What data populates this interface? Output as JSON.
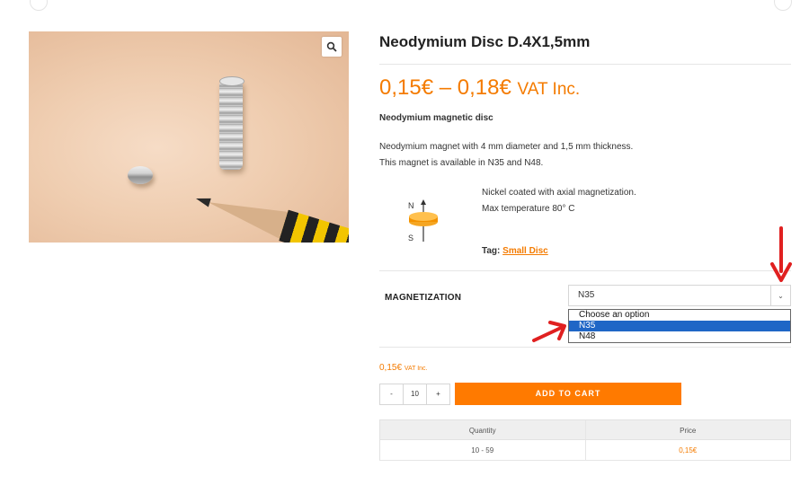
{
  "product": {
    "title": "Neodymium Disc D.4X1,5mm",
    "price_range": "0,15€ – 0,18€",
    "price_vat": "VAT Inc.",
    "short_title": "Neodymium magnetic disc",
    "desc_line1": "Neodymium magnet with 4 mm diameter and 1,5 mm thickness.",
    "desc_line2": "This magnet is available in N35 and N48.",
    "feature1": "Nickel coated with axial magnetization.",
    "feature2": "Max temperature 80° C",
    "diagram_n": "N",
    "diagram_s": "S",
    "tag_label": "Tag:",
    "tag_value": "Small Disc"
  },
  "variation": {
    "label": "MAGNETIZATION",
    "selected": "N35",
    "options": [
      "Choose an option",
      "N35",
      "N48"
    ],
    "highlighted_index": 1
  },
  "cart": {
    "price": "0,15€",
    "price_vat": "VAT Inc.",
    "minus": "-",
    "quantity": "10",
    "plus": "+",
    "add_label": "ADD TO CART"
  },
  "pricing_table": {
    "headers": [
      "Quantity",
      "Price"
    ],
    "rows": [
      [
        "10 - 59",
        "0,15€"
      ]
    ]
  },
  "colors": {
    "accent": "#f47b00",
    "button": "#ff7a00",
    "highlight": "#1f66c6",
    "annotation_arrow": "#e02020"
  },
  "icons": {
    "zoom": "magnifier-icon",
    "select_caret": "chevron-down-icon"
  }
}
